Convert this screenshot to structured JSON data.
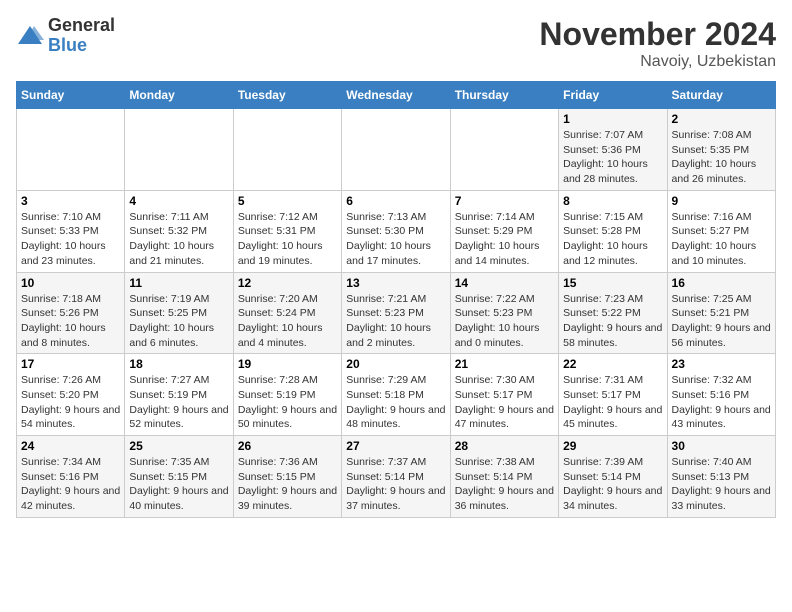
{
  "header": {
    "logo_general": "General",
    "logo_blue": "Blue",
    "month_title": "November 2024",
    "location": "Navoiy, Uzbekistan"
  },
  "days_of_week": [
    "Sunday",
    "Monday",
    "Tuesday",
    "Wednesday",
    "Thursday",
    "Friday",
    "Saturday"
  ],
  "weeks": [
    [
      {
        "day": "",
        "info": ""
      },
      {
        "day": "",
        "info": ""
      },
      {
        "day": "",
        "info": ""
      },
      {
        "day": "",
        "info": ""
      },
      {
        "day": "",
        "info": ""
      },
      {
        "day": "1",
        "info": "Sunrise: 7:07 AM\nSunset: 5:36 PM\nDaylight: 10 hours and 28 minutes."
      },
      {
        "day": "2",
        "info": "Sunrise: 7:08 AM\nSunset: 5:35 PM\nDaylight: 10 hours and 26 minutes."
      }
    ],
    [
      {
        "day": "3",
        "info": "Sunrise: 7:10 AM\nSunset: 5:33 PM\nDaylight: 10 hours and 23 minutes."
      },
      {
        "day": "4",
        "info": "Sunrise: 7:11 AM\nSunset: 5:32 PM\nDaylight: 10 hours and 21 minutes."
      },
      {
        "day": "5",
        "info": "Sunrise: 7:12 AM\nSunset: 5:31 PM\nDaylight: 10 hours and 19 minutes."
      },
      {
        "day": "6",
        "info": "Sunrise: 7:13 AM\nSunset: 5:30 PM\nDaylight: 10 hours and 17 minutes."
      },
      {
        "day": "7",
        "info": "Sunrise: 7:14 AM\nSunset: 5:29 PM\nDaylight: 10 hours and 14 minutes."
      },
      {
        "day": "8",
        "info": "Sunrise: 7:15 AM\nSunset: 5:28 PM\nDaylight: 10 hours and 12 minutes."
      },
      {
        "day": "9",
        "info": "Sunrise: 7:16 AM\nSunset: 5:27 PM\nDaylight: 10 hours and 10 minutes."
      }
    ],
    [
      {
        "day": "10",
        "info": "Sunrise: 7:18 AM\nSunset: 5:26 PM\nDaylight: 10 hours and 8 minutes."
      },
      {
        "day": "11",
        "info": "Sunrise: 7:19 AM\nSunset: 5:25 PM\nDaylight: 10 hours and 6 minutes."
      },
      {
        "day": "12",
        "info": "Sunrise: 7:20 AM\nSunset: 5:24 PM\nDaylight: 10 hours and 4 minutes."
      },
      {
        "day": "13",
        "info": "Sunrise: 7:21 AM\nSunset: 5:23 PM\nDaylight: 10 hours and 2 minutes."
      },
      {
        "day": "14",
        "info": "Sunrise: 7:22 AM\nSunset: 5:23 PM\nDaylight: 10 hours and 0 minutes."
      },
      {
        "day": "15",
        "info": "Sunrise: 7:23 AM\nSunset: 5:22 PM\nDaylight: 9 hours and 58 minutes."
      },
      {
        "day": "16",
        "info": "Sunrise: 7:25 AM\nSunset: 5:21 PM\nDaylight: 9 hours and 56 minutes."
      }
    ],
    [
      {
        "day": "17",
        "info": "Sunrise: 7:26 AM\nSunset: 5:20 PM\nDaylight: 9 hours and 54 minutes."
      },
      {
        "day": "18",
        "info": "Sunrise: 7:27 AM\nSunset: 5:19 PM\nDaylight: 9 hours and 52 minutes."
      },
      {
        "day": "19",
        "info": "Sunrise: 7:28 AM\nSunset: 5:19 PM\nDaylight: 9 hours and 50 minutes."
      },
      {
        "day": "20",
        "info": "Sunrise: 7:29 AM\nSunset: 5:18 PM\nDaylight: 9 hours and 48 minutes."
      },
      {
        "day": "21",
        "info": "Sunrise: 7:30 AM\nSunset: 5:17 PM\nDaylight: 9 hours and 47 minutes."
      },
      {
        "day": "22",
        "info": "Sunrise: 7:31 AM\nSunset: 5:17 PM\nDaylight: 9 hours and 45 minutes."
      },
      {
        "day": "23",
        "info": "Sunrise: 7:32 AM\nSunset: 5:16 PM\nDaylight: 9 hours and 43 minutes."
      }
    ],
    [
      {
        "day": "24",
        "info": "Sunrise: 7:34 AM\nSunset: 5:16 PM\nDaylight: 9 hours and 42 minutes."
      },
      {
        "day": "25",
        "info": "Sunrise: 7:35 AM\nSunset: 5:15 PM\nDaylight: 9 hours and 40 minutes."
      },
      {
        "day": "26",
        "info": "Sunrise: 7:36 AM\nSunset: 5:15 PM\nDaylight: 9 hours and 39 minutes."
      },
      {
        "day": "27",
        "info": "Sunrise: 7:37 AM\nSunset: 5:14 PM\nDaylight: 9 hours and 37 minutes."
      },
      {
        "day": "28",
        "info": "Sunrise: 7:38 AM\nSunset: 5:14 PM\nDaylight: 9 hours and 36 minutes."
      },
      {
        "day": "29",
        "info": "Sunrise: 7:39 AM\nSunset: 5:14 PM\nDaylight: 9 hours and 34 minutes."
      },
      {
        "day": "30",
        "info": "Sunrise: 7:40 AM\nSunset: 5:13 PM\nDaylight: 9 hours and 33 minutes."
      }
    ]
  ]
}
